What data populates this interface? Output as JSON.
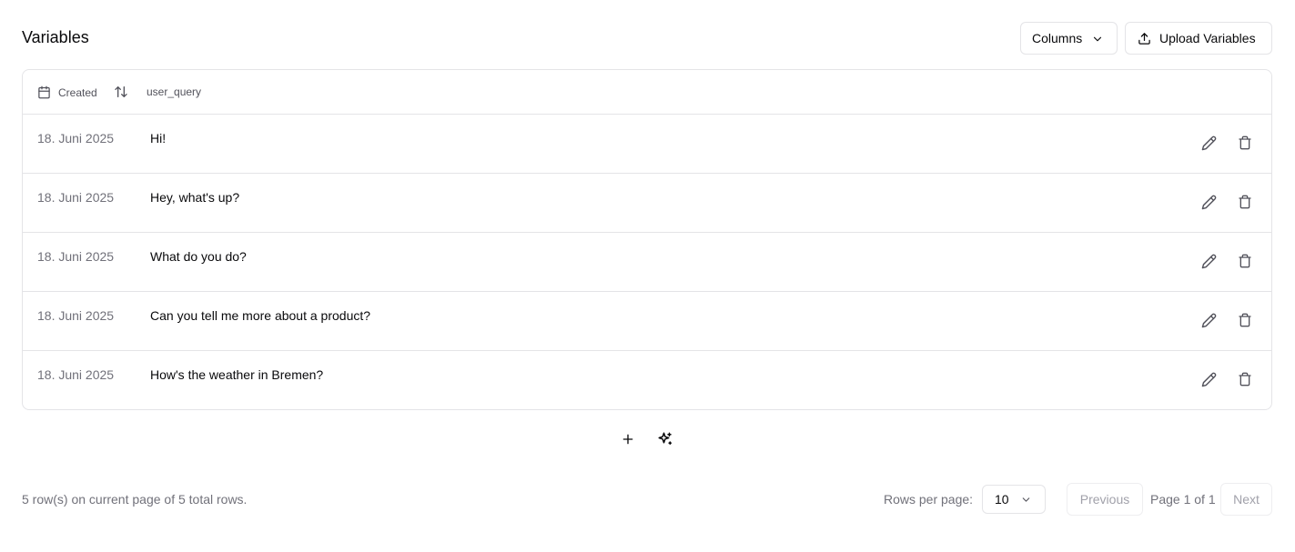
{
  "header": {
    "title": "Variables",
    "columns_label": "Columns",
    "upload_label": "Upload Variables"
  },
  "table": {
    "columns": {
      "created": "Created",
      "query": "user_query"
    },
    "rows": [
      {
        "created": "18. Juni 2025",
        "user_query": "Hi!"
      },
      {
        "created": "18. Juni 2025",
        "user_query": "Hey, what's up?"
      },
      {
        "created": "18. Juni 2025",
        "user_query": "What do you do?"
      },
      {
        "created": "18. Juni 2025",
        "user_query": "Can you tell me more about a product?"
      },
      {
        "created": "18. Juni 2025",
        "user_query": "How's the weather in Bremen?"
      }
    ]
  },
  "footer": {
    "row_info": "5 row(s) on current page of 5 total rows.",
    "rows_per_page_label": "Rows per page:",
    "rows_per_page_value": "10",
    "previous_label": "Previous",
    "page_info": "Page 1 of 1",
    "next_label": "Next"
  },
  "icons": {
    "calendar": "calendar-icon",
    "sort": "sort-arrows-icon",
    "edit": "pencil-icon",
    "delete": "trash-icon",
    "add": "plus-icon",
    "generate": "sparkles-icon",
    "chevron": "chevron-down-icon",
    "upload": "upload-icon"
  }
}
